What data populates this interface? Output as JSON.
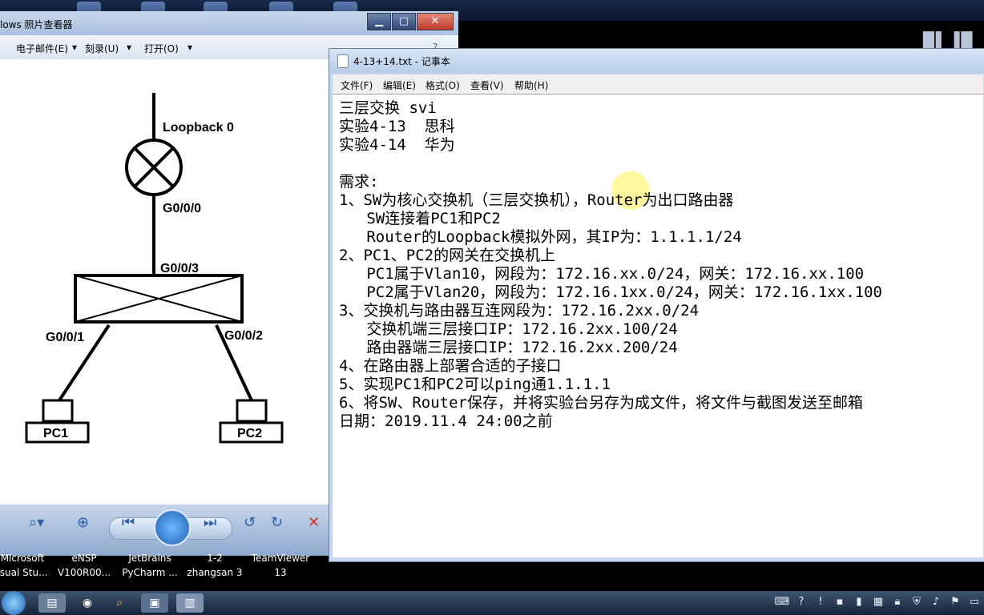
{
  "photo_viewer": {
    "title": "lows 照片查看器",
    "menu": [
      {
        "label": "电子邮件(E)"
      },
      {
        "label": "刻录(U)"
      },
      {
        "label": "打开(O)"
      }
    ],
    "diagram": {
      "loopback_label": "Loopback 0",
      "router_port": "G0/0/0",
      "switch_up_port": "G0/0/3",
      "switch_left_port": "G0/0/1",
      "switch_right_port": "G0/0/2",
      "pc1_label": "PC1",
      "pc2_label": "PC2"
    }
  },
  "desktop": {
    "apps": [
      {
        "line1": "Microsoft",
        "line2": "isual Stu..."
      },
      {
        "line1": "eNSP",
        "line2": "V100R00..."
      },
      {
        "line1": "JetBrains",
        "line2": "PyCharm ..."
      },
      {
        "line1": "1-2",
        "line2": "zhangsan 3"
      },
      {
        "line1": "TeamViewer",
        "line2": "13"
      }
    ]
  },
  "notepad": {
    "title": "4-13+14.txt - 记事本",
    "menu": [
      {
        "label": "文件(F)"
      },
      {
        "label": "编辑(E)"
      },
      {
        "label": "格式(O)"
      },
      {
        "label": "查看(V)"
      },
      {
        "label": "帮助(H)"
      }
    ],
    "lines": [
      "三层交换 svi",
      "实验4-13  思科",
      "实验4-14  华为",
      "",
      "需求:",
      "1、SW为核心交换机（三层交换机），Router为出口路由器",
      "   SW连接着PC1和PC2",
      "   Router的Loopback模拟外网，其IP为：1.1.1.1/24",
      "2、PC1、PC2的网关在交换机上",
      "   PC1属于Vlan10，网段为：172.16.xx.0/24，网关：172.16.xx.100",
      "   PC2属于Vlan20，网段为：172.16.1xx.0/24，网关：172.16.1xx.100",
      "3、交换机与路由器互连网段为：172.16.2xx.0/24",
      "   交换机端三层接口IP：172.16.2xx.100/24",
      "   路由器端三层接口IP：172.16.2xx.200/24",
      "4、在路由器上部署合适的子接口",
      "5、实现PC1和PC2可以ping通1.1.1.1",
      "6、将SW、Router保存，并将实验台另存为成文件，将文件与截图发送至邮箱",
      "日期：2019.11.4 24:00之前"
    ]
  },
  "colors": {
    "title_bar": "#b9cde8",
    "taskbar": "#16243a",
    "highlight": "#fff050"
  }
}
